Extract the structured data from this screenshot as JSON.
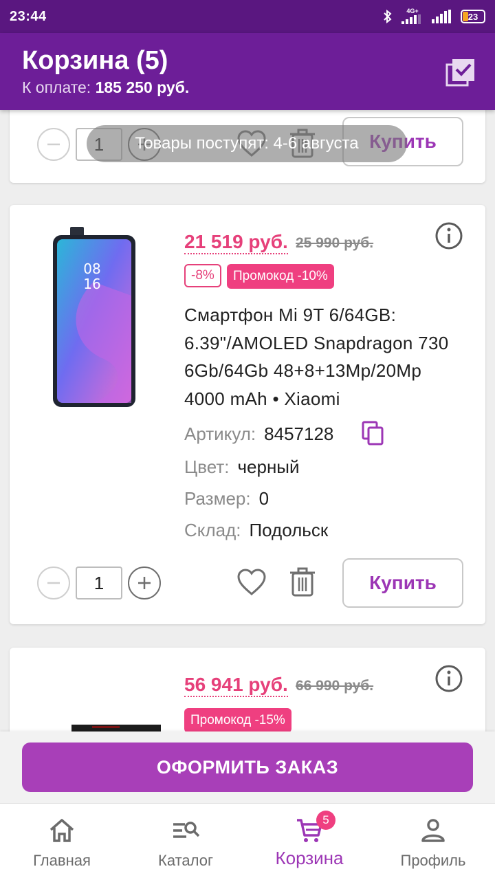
{
  "status_bar": {
    "time": "23:44",
    "network": "4G+",
    "battery": "23"
  },
  "header": {
    "title": "Корзина (5)",
    "pay_label": "К оплате:",
    "pay_amount": "185 250 руб."
  },
  "toast": "Товары поступят: 4-6 августа",
  "cart_items": [
    {
      "quantity": "1",
      "buy_label": "Купить"
    },
    {
      "price": "21 519 руб.",
      "old_price": "25 990 руб.",
      "discount_badge": "-8%",
      "promo_badge": "Промокод -10%",
      "name": "Смартфон Mi 9T 6/64GB: 6.39\"/AMOLED Snapdragon 730 6Gb/64Gb 48+8+13Mp/20Mp 4000 mAh • Xiaomi",
      "attributes": [
        {
          "key": "Артикул:",
          "value": "8457128"
        },
        {
          "key": "Цвет:",
          "value": "черный"
        },
        {
          "key": "Размер:",
          "value": "0"
        },
        {
          "key": "Склад:",
          "value": "Подольск"
        }
      ],
      "phone_clock": [
        "08",
        "16"
      ],
      "quantity": "1",
      "buy_label": "Купить"
    },
    {
      "price": "56 941 руб.",
      "old_price": "66 990 руб.",
      "promo_badge": "Промокод -15%"
    }
  ],
  "checkout_label": "ОФОРМИТЬ ЗАКАЗ",
  "nav": {
    "items": [
      {
        "label": "Главная",
        "icon": "home-icon"
      },
      {
        "label": "Каталог",
        "icon": "catalog-search-icon"
      },
      {
        "label": "Корзина",
        "icon": "cart-icon",
        "badge": "5",
        "active": true
      },
      {
        "label": "Профиль",
        "icon": "profile-icon"
      }
    ]
  },
  "colors": {
    "status_bar": "#5a1780",
    "header": "#6d1e98",
    "accent": "#9c36b5",
    "price": "#e6407a",
    "checkout": "#a83fb8"
  }
}
